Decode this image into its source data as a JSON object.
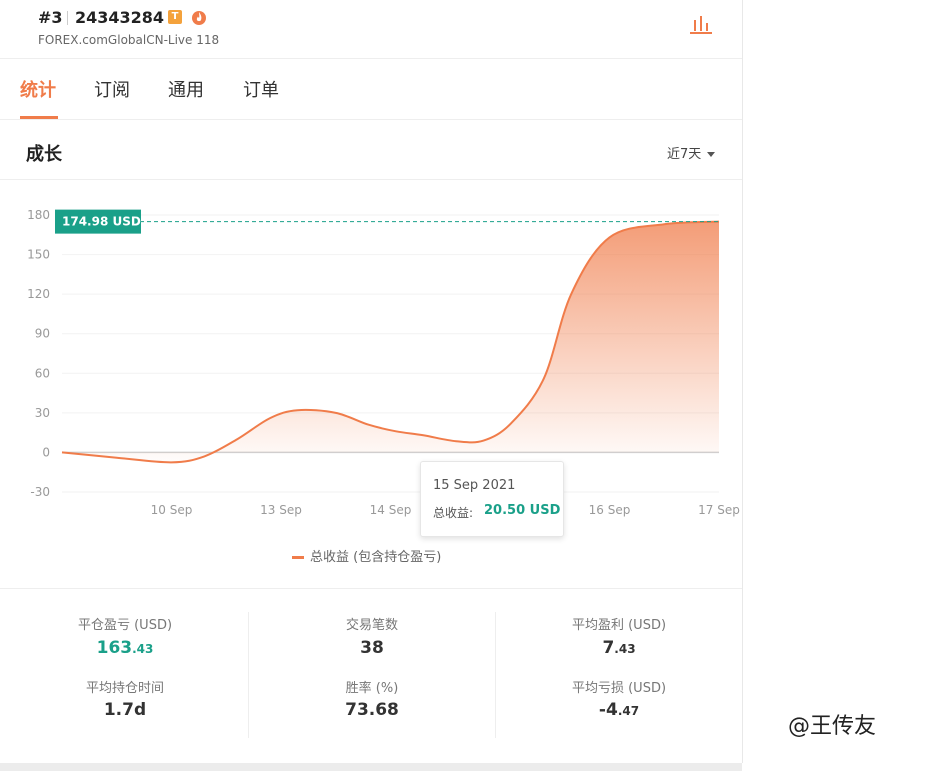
{
  "header": {
    "rank": "#3",
    "account_id": "24343284",
    "badge": "T",
    "server": "FOREX.comGlobalCN-Live 118"
  },
  "icons": {
    "badge": "t-badge-icon",
    "flame": "flame-icon",
    "chart": "bar-chart-icon",
    "caret": "caret-down-icon"
  },
  "colors": {
    "accent": "#f07c4a",
    "positive": "#1aa089",
    "label_bg": "#1aa089"
  },
  "tabs": [
    {
      "label": "统计",
      "active": true
    },
    {
      "label": "订阅",
      "active": false
    },
    {
      "label": "通用",
      "active": false
    },
    {
      "label": "订单",
      "active": false
    }
  ],
  "growth": {
    "title": "成长",
    "period": "近7天"
  },
  "chart_data": {
    "type": "area",
    "y_ticks": [
      "180",
      "150",
      "120",
      "90",
      "60",
      "30",
      "0",
      "-30"
    ],
    "x_ticks": [
      "10 Sep",
      "13 Sep",
      "14 Sep",
      "15 Sep",
      "16 Sep",
      "17 Sep"
    ],
    "ylim": [
      -30,
      180
    ],
    "series": [
      {
        "name": "总收益 (包含持仓盈亏)",
        "points": [
          {
            "x": 0.0,
            "y": 0
          },
          {
            "x": 0.5,
            "y": -4
          },
          {
            "x": 1.0,
            "y": -7.5
          },
          {
            "x": 1.3,
            "y": -3
          },
          {
            "x": 1.6,
            "y": 10
          },
          {
            "x": 1.9,
            "y": 26
          },
          {
            "x": 2.15,
            "y": 32
          },
          {
            "x": 2.5,
            "y": 30
          },
          {
            "x": 2.8,
            "y": 21
          },
          {
            "x": 3.05,
            "y": 16
          },
          {
            "x": 3.3,
            "y": 13
          },
          {
            "x": 3.6,
            "y": 8.5
          },
          {
            "x": 3.85,
            "y": 9
          },
          {
            "x": 4.1,
            "y": 22
          },
          {
            "x": 4.4,
            "y": 56
          },
          {
            "x": 4.65,
            "y": 120
          },
          {
            "x": 5.0,
            "y": 163
          },
          {
            "x": 5.5,
            "y": 173
          },
          {
            "x": 6.0,
            "y": 174.98
          }
        ]
      }
    ],
    "last_value_label": "174.98 USD",
    "tooltip": {
      "date": "15 Sep 2021",
      "label": "总收益:",
      "value": "20.50 USD"
    },
    "legend": "总收益 (包含持仓盈亏)"
  },
  "stats": [
    {
      "label": "平仓盈亏 (USD)",
      "int": "163",
      "dec": ".43",
      "positive": true
    },
    {
      "label": "交易笔数",
      "int": "38",
      "dec": "",
      "positive": false
    },
    {
      "label": "平均盈利 (USD)",
      "int": "7",
      "dec": ".43",
      "positive": false
    },
    {
      "label": "平均持仓时间",
      "int": "1.7d",
      "dec": "",
      "positive": false
    },
    {
      "label": "胜率 (%)",
      "int": "73.68",
      "dec": "",
      "positive": false
    },
    {
      "label": "平均亏损 (USD)",
      "int": "-4",
      "dec": ".47",
      "positive": false
    }
  ],
  "watermark": "@王传友"
}
